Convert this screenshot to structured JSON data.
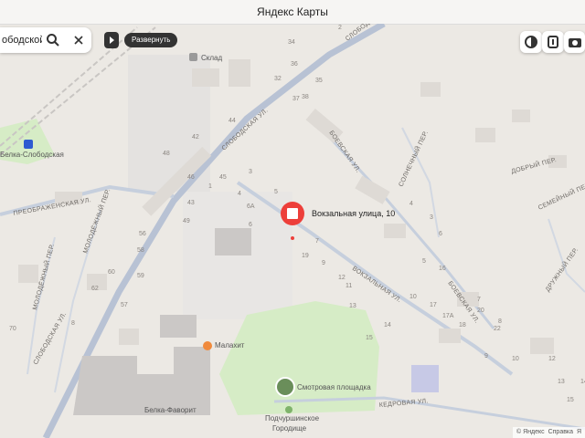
{
  "window": {
    "title": "Яндекс Карты"
  },
  "search": {
    "query": "ободской, ул"
  },
  "controls": {
    "expand_label": "Развернуть"
  },
  "selected_place": {
    "label": "Вокзальная улица, 10"
  },
  "streets": {
    "slobodskaya_top": "СЛОБОДСКАЯ УЛ.",
    "slobodskaya_mid": "СЛОБОДСКАЯ УЛ.",
    "slobodskaya_bottom": "СЛОБОДСКАЯ УЛ.",
    "preobrazhenskaya": "ПРЕОБРАЖЕНСКАЯ УЛ.",
    "molodezhny_1": "МОЛОДЁЖНЫЙ ПЕР.",
    "molodezhny_2": "МОЛОДЁЖНЫЙ ПЕР.",
    "boyevskaya_top": "БОЕВСКАЯ УЛ.",
    "boyevskaya_bottom": "БОЕВСКАЯ УЛ.",
    "vokzalnaya": "ВОКЗАЛЬНАЯ УЛ.",
    "solnechny": "СОЛНЕЧНЫЙ ПЕР.",
    "dobry": "ДОБРЫЙ ПЕР.",
    "semeyny": "СЕМЕЙНЫЙ ПЕР.",
    "druzhny": "ДРУЖНЫЙ ПЕР.",
    "kedrovaya": "КЕДРОВАЯ УЛ."
  },
  "pois": {
    "sklad": "Склад",
    "station": "Белка-Слободская",
    "malakhit": "Малахит",
    "belka_favorit": "Белка-Фаворит",
    "viewpoint": "Смотровая площадка",
    "gorodishche_1": "Подчуршинское",
    "gorodishche_2": "Городище"
  },
  "house_numbers": [
    "2",
    "34",
    "36",
    "32",
    "38",
    "35",
    "37",
    "44",
    "42",
    "48",
    "46",
    "45",
    "3",
    "1",
    "5",
    "4",
    "43",
    "49",
    "6А",
    "6",
    "7",
    "19",
    "56",
    "58",
    "60",
    "62",
    "59",
    "57",
    "70",
    "8",
    "9",
    "11",
    "13",
    "15",
    "12",
    "14",
    "10",
    "16",
    "17",
    "17А",
    "18",
    "20",
    "22",
    "3",
    "4",
    "5",
    "6",
    "7",
    "8",
    "9",
    "10",
    "12",
    "13",
    "14",
    "15"
  ],
  "attribution": {
    "copyright": "© Яндекс",
    "help": "Справка",
    "extra": "Я"
  },
  "colors": {
    "accent": "#ed3f3a",
    "road": "#b8c2d4",
    "park": "#d6ecc6",
    "background": "#ece9e4"
  }
}
